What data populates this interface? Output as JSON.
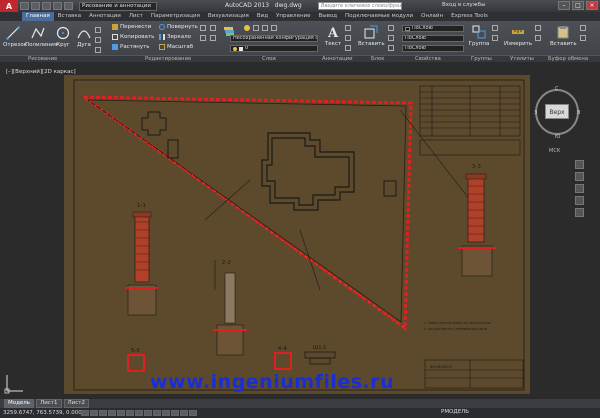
{
  "title_bar": {
    "app_logo": "A",
    "workspace": "Рисование и аннотации",
    "app_title": "AutoCAD 2013",
    "file_name": "dwg.dwg",
    "search_placeholder": "Введите ключевое слово/фразу",
    "sign_in": "Вход в службы",
    "minimize": "–",
    "maximize": "□",
    "close": "×"
  },
  "tabs": [
    "Главная",
    "Вставка",
    "Аннотации",
    "Лист",
    "Параметризация",
    "Визуализация",
    "Вид",
    "Управление",
    "Вывод",
    "Подключаемые модули",
    "Онлайн",
    "Express Tools"
  ],
  "ribbon": {
    "draw": {
      "line": "Отрезок",
      "polyline": "Полилиния",
      "circle": "Круг",
      "arc": "Дуга"
    },
    "modify": {
      "move": "Перенести",
      "rotate": "Повернуть",
      "copy": "Копировать",
      "mirror": "Зеркало",
      "stretch": "Растянуть",
      "scale": "Масштаб"
    },
    "layers": {
      "combo": "Несохраненная конфигурация сло",
      "layer_value": "0"
    },
    "annotation": {
      "text": "Текст"
    },
    "block": {
      "insert": "Вставить"
    },
    "properties": {
      "bylayer1": "ПоСлою",
      "bylayer2": "ПоСлою",
      "bylayer3": "ПоСлою"
    },
    "groups": {
      "group": "Группа"
    },
    "utilities": {
      "measure": "Измерить"
    },
    "clipboard": {
      "paste": "Вставить"
    }
  },
  "panels": [
    "Рисование",
    "Редактирование",
    "Слои",
    "Аннотации",
    "Блок",
    "Свойства",
    "Группы",
    "Утилиты",
    "Буфер обмена"
  ],
  "viewport": {
    "label": "[–][Верхний][2D каркас]",
    "view_cube": "Верх",
    "wcs": "МСК"
  },
  "compass": {
    "n": "С",
    "s": "Ю",
    "w": "З",
    "e": "В"
  },
  "drawing": {
    "sections": [
      "1–1",
      "2–2",
      "3–3",
      "4–4",
      "5–5",
      "Ш1.1"
    ],
    "title_block": "ФУНДАМЕНТ",
    "note1": "1. СМЕСЬ БЕТОНА ВЗЯТЬ ПО ТЕХНОЛОГИИ",
    "note2": "2. КЛАДКУ ВЕСТИ С ПЕРЕВЯЗКОЙ ШВОВ"
  },
  "layout_tabs": [
    "Модель",
    "Лист1",
    "Лист2"
  ],
  "status": {
    "coords": "3259.6747, 763.5739, 0.0000",
    "model": "РМОДЕЛЬ"
  },
  "watermark": "www.ingeniumfiles.ru"
}
